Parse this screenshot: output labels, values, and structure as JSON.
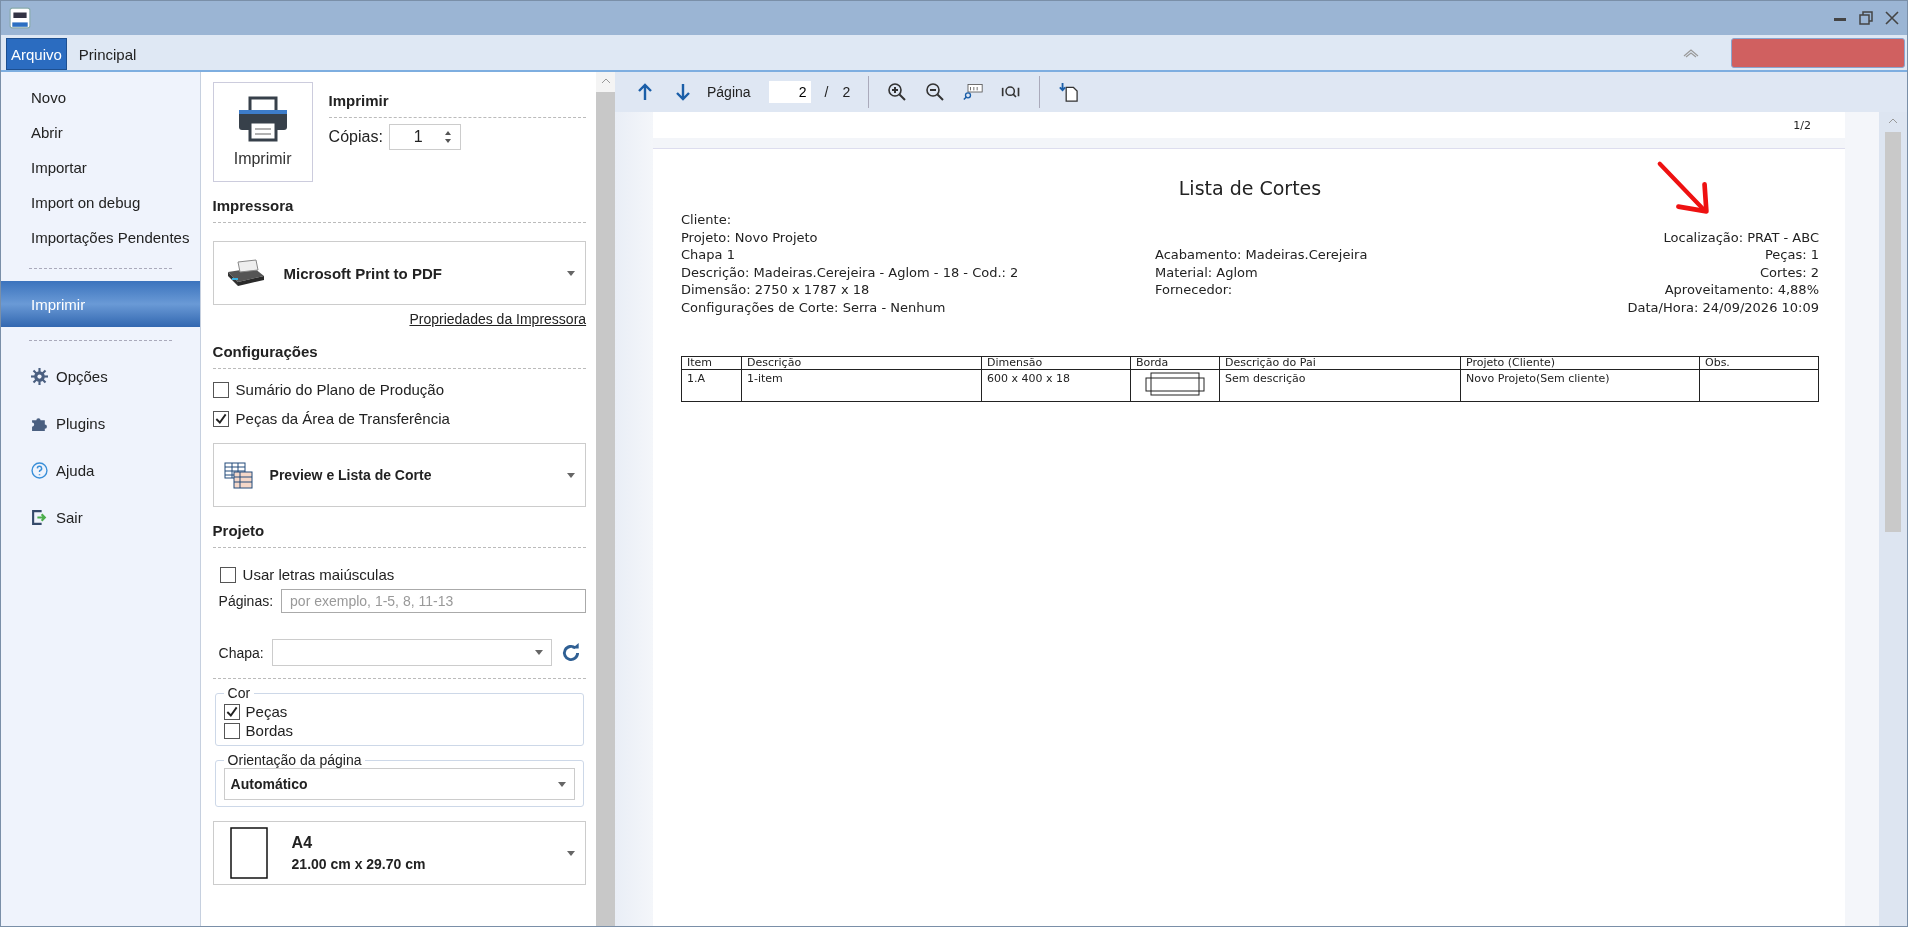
{
  "tabs": [
    {
      "label": "Arquivo",
      "selected": true
    },
    {
      "label": "Principal",
      "selected": false
    }
  ],
  "menu_groups": [
    [
      {
        "label": "Novo",
        "selected": false
      },
      {
        "label": "Abrir",
        "selected": false
      },
      {
        "label": "Importar",
        "selected": false
      },
      {
        "label": "Import on debug",
        "selected": false
      },
      {
        "label": "Importações Pendentes",
        "selected": false
      }
    ],
    [
      {
        "label": "Imprimir",
        "selected": true
      }
    ],
    [
      {
        "label": "Opções",
        "selected": false
      },
      {
        "label": "Plugins",
        "selected": false
      },
      {
        "label": "Ajuda",
        "selected": false
      },
      {
        "label": "Sair",
        "selected": false
      }
    ]
  ],
  "print": {
    "heading": "Imprimir",
    "button": "Imprimir",
    "copies_label": "Cópias:",
    "copies": "1"
  },
  "printer": {
    "heading": "Impressora",
    "name": "Microsoft Print to PDF",
    "properties_link": "Propriedades da Impressora"
  },
  "settings": {
    "heading": "Configurações",
    "checks": [
      {
        "label": "Sumário do Plano de Produção",
        "checked": false
      },
      {
        "label": "Peças da Área de Transferência",
        "checked": true
      }
    ],
    "report": "Preview e Lista de Corte"
  },
  "project": {
    "heading": "Projeto",
    "uppercase": {
      "label": "Usar letras maiúsculas",
      "checked": false
    },
    "pages_label": "Páginas:",
    "pages_placeholder": "por exemplo, 1-5, 8, 11-13",
    "sheet_label": "Chapa:",
    "color": {
      "legend": "Cor",
      "checks": [
        {
          "label": "Peças",
          "checked": true
        },
        {
          "label": "Bordas",
          "checked": false
        }
      ]
    },
    "orientation": {
      "legend": "Orientação da página",
      "value": "Automático"
    },
    "paper": {
      "name": "A4",
      "size": "21.00 cm x 29.70 cm"
    }
  },
  "toolbar": {
    "page_label": "Página",
    "page": "2",
    "slash": "/",
    "total": "2"
  },
  "previous_page_footer": "1/2",
  "report": {
    "title": "Lista de Cortes",
    "left": [
      "Cliente:",
      "Projeto: Novo Projeto",
      "Chapa 1",
      "Descrição: Madeiras.Cerejeira - Aglom - 18 - Cod.: 2",
      "Dimensão: 2750 x 1787 x 18",
      "Configurações de Corte: Serra - Nenhum"
    ],
    "middle": [
      "Acabamento: Madeiras.Cerejeira",
      "Material: Aglom",
      "Fornecedor:"
    ],
    "right": [
      "Localização: PRAT - ABC",
      "Peças: 1",
      "Cortes: 2",
      "Aproveitamento: 4,88%",
      "Data/Hora: 24/09/2026 10:09"
    ],
    "columns": [
      "Item",
      "Descrição",
      "Dimensão",
      "Borda",
      "Descrição do Pai",
      "Projeto (Cliente)",
      "Obs."
    ],
    "rows": [
      {
        "cells": [
          "1.A",
          "1-item",
          "600 x 400 x 18",
          {
            "kind": "edge_drawing"
          },
          "Sem descrição",
          "Novo Projeto(Sem cliente)",
          null
        ]
      }
    ]
  }
}
